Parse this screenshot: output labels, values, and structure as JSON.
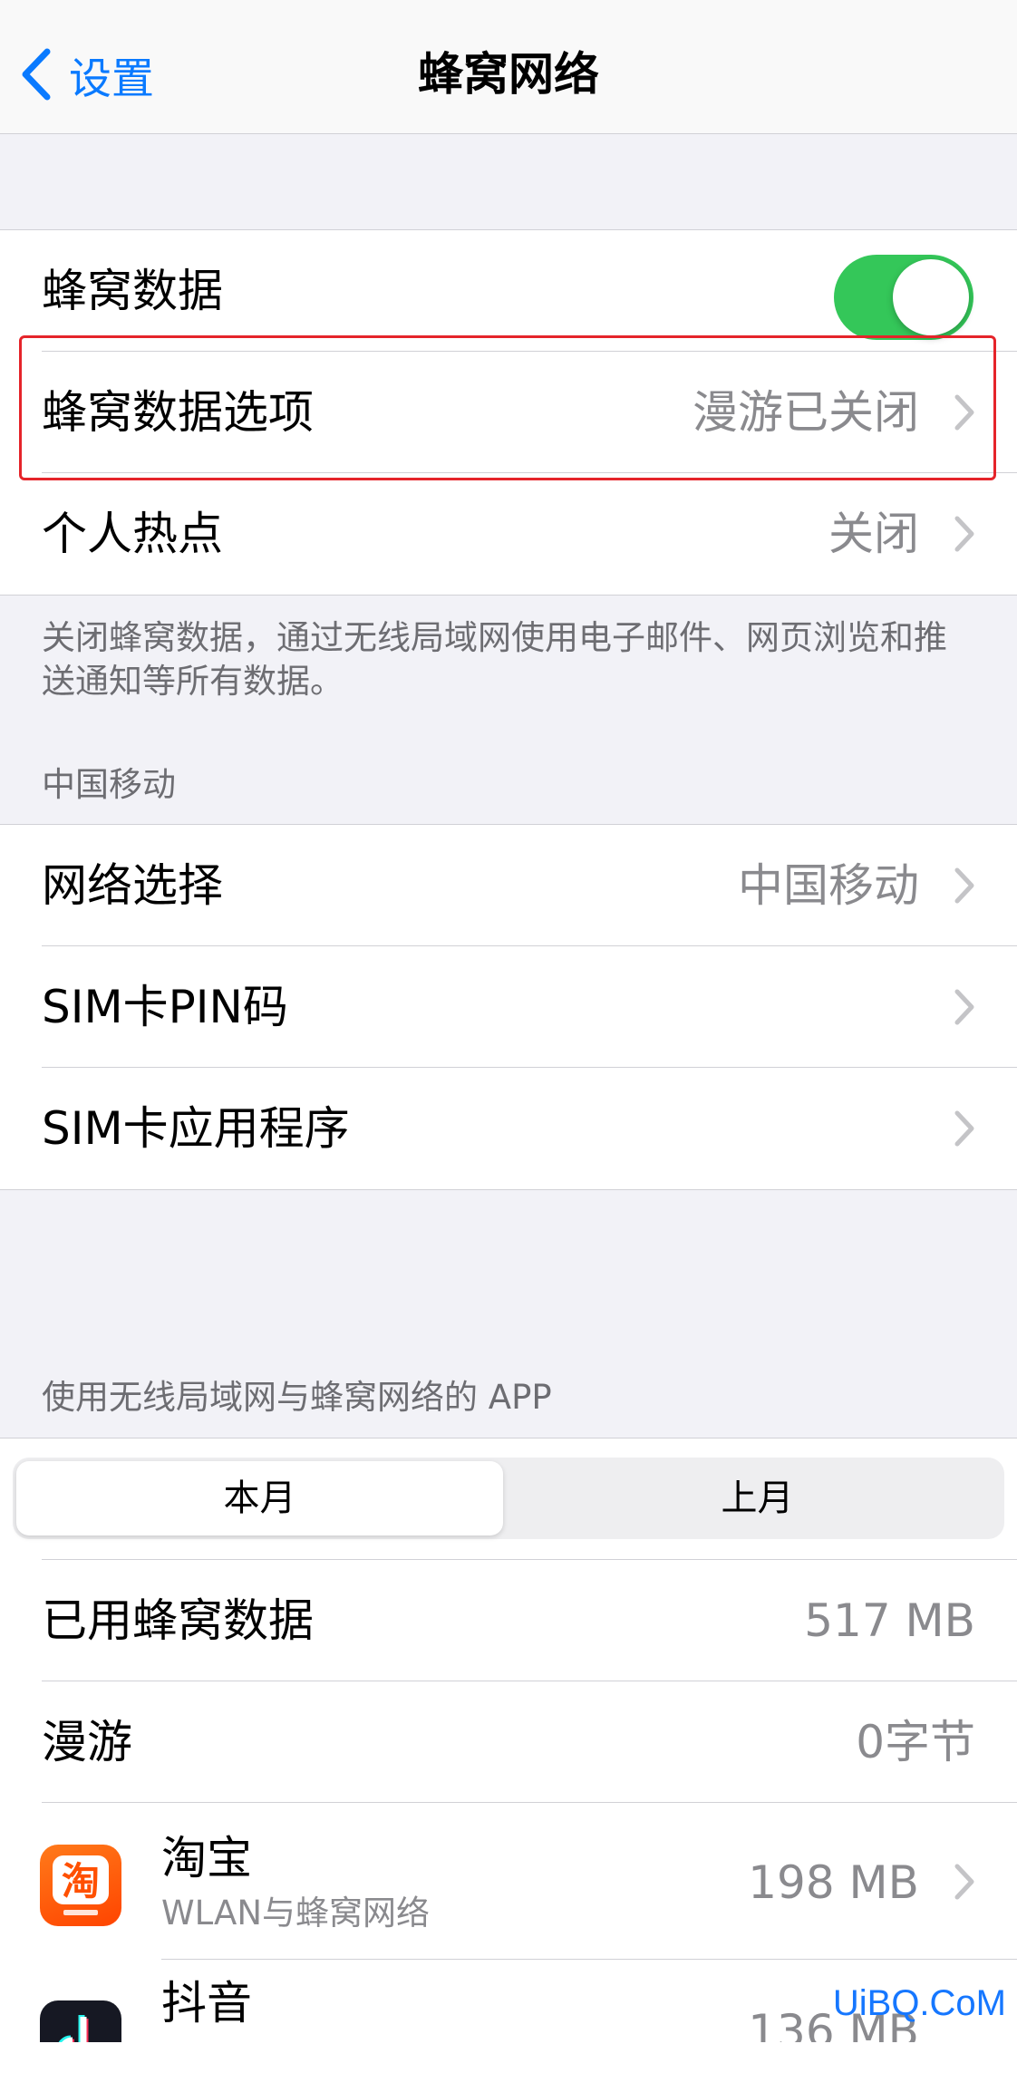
{
  "navbar": {
    "back_label": "设置",
    "title": "蜂窝网络"
  },
  "cellular_group": {
    "cellular_data_label": "蜂窝数据",
    "cellular_data_on": true,
    "data_options_label": "蜂窝数据选项",
    "data_options_value": "漫游已关闭",
    "hotspot_label": "个人热点",
    "hotspot_value": "关闭"
  },
  "cellular_footnote": "关闭蜂窝数据，通过无线局域网使用电子邮件、网页浏览和推送通知等所有数据。",
  "carrier_header": "中国移动",
  "carrier_group": {
    "network_select_label": "网络选择",
    "network_select_value": "中国移动",
    "sim_pin_label": "SIM卡PIN码",
    "sim_apps_label": "SIM卡应用程序"
  },
  "apps_header": "使用无线局域网与蜂窝网络的 APP",
  "segment": {
    "this_month": "本月",
    "last_month": "上月",
    "selected": "本月"
  },
  "usage": {
    "used_label": "已用蜂窝数据",
    "used_value": "517 MB",
    "roaming_label": "漫游",
    "roaming_value": "0字节"
  },
  "apps": [
    {
      "name": "淘宝",
      "sub": "WLAN与蜂窝网络",
      "size": "198 MB",
      "icon": "taobao-icon",
      "icon_glyph": "淘",
      "color": "#ff5000"
    },
    {
      "name": "抖音",
      "sub": "",
      "size": "136 MB",
      "icon": "douyin-icon",
      "color": "#161823"
    }
  ],
  "watermark": "UiBQ.CoM",
  "colors": {
    "accent": "#0a7aff",
    "toggle_on": "#34c759",
    "highlight": "#e5242a"
  }
}
